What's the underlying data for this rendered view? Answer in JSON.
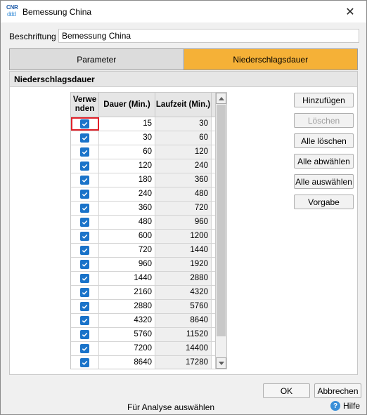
{
  "window": {
    "title": "Bemessung China",
    "icon_text": "CNR",
    "icon_drops": "ddd",
    "close_glyph": "✕"
  },
  "caption": {
    "label": "Beschriftung",
    "value": "Bemessung China"
  },
  "tabs": [
    {
      "label": "Parameter",
      "active": false
    },
    {
      "label": "Niederschlagsdauer",
      "active": true
    }
  ],
  "section": {
    "title": "Niederschlagsdauer"
  },
  "grid": {
    "columns": [
      "Verwe nden",
      "Dauer (Min.)",
      "Laufzeit (Min.)"
    ],
    "rows": [
      {
        "use": true,
        "dauer": "15",
        "laufzeit": "30"
      },
      {
        "use": true,
        "dauer": "30",
        "laufzeit": "60"
      },
      {
        "use": true,
        "dauer": "60",
        "laufzeit": "120"
      },
      {
        "use": true,
        "dauer": "120",
        "laufzeit": "240"
      },
      {
        "use": true,
        "dauer": "180",
        "laufzeit": "360"
      },
      {
        "use": true,
        "dauer": "240",
        "laufzeit": "480"
      },
      {
        "use": true,
        "dauer": "360",
        "laufzeit": "720"
      },
      {
        "use": true,
        "dauer": "480",
        "laufzeit": "960"
      },
      {
        "use": true,
        "dauer": "600",
        "laufzeit": "1200"
      },
      {
        "use": true,
        "dauer": "720",
        "laufzeit": "1440"
      },
      {
        "use": true,
        "dauer": "960",
        "laufzeit": "1920"
      },
      {
        "use": true,
        "dauer": "1440",
        "laufzeit": "2880"
      },
      {
        "use": true,
        "dauer": "2160",
        "laufzeit": "4320"
      },
      {
        "use": true,
        "dauer": "2880",
        "laufzeit": "5760"
      },
      {
        "use": true,
        "dauer": "4320",
        "laufzeit": "8640"
      },
      {
        "use": true,
        "dauer": "5760",
        "laufzeit": "11520"
      },
      {
        "use": true,
        "dauer": "7200",
        "laufzeit": "14400"
      },
      {
        "use": true,
        "dauer": "8640",
        "laufzeit": "17280"
      }
    ]
  },
  "side_buttons": [
    {
      "label": "Hinzufügen",
      "disabled": false
    },
    {
      "label": "Löschen",
      "disabled": true
    },
    {
      "label": "Alle löschen",
      "disabled": false
    },
    {
      "label": "Alle abwählen",
      "disabled": false
    },
    {
      "label": "Alle auswählen",
      "disabled": false
    },
    {
      "label": "Vorgabe",
      "disabled": false
    }
  ],
  "footer": {
    "ok_label": "OK",
    "cancel_label": "Abbrechen"
  },
  "status": {
    "text": "Für Analyse auswählen",
    "help_label": "Hilfe",
    "help_glyph": "?"
  },
  "colors": {
    "active_tab": "#f5b137",
    "checkbox": "#1a73c9",
    "focus_outline": "#e0212a"
  }
}
